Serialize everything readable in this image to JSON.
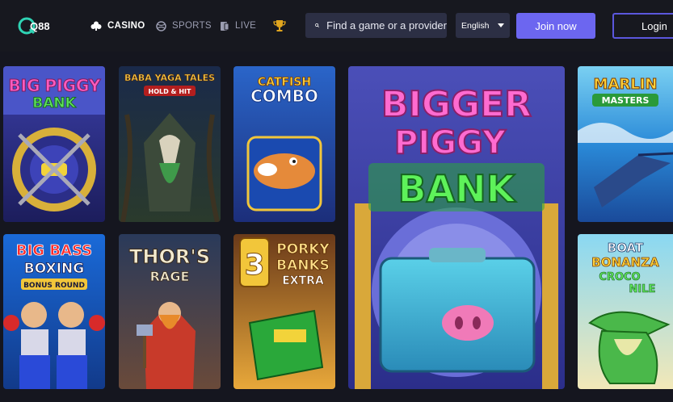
{
  "header": {
    "logo_text": "Q88",
    "nav": [
      {
        "label": "CASINO",
        "icon": "clubs-icon",
        "active": true
      },
      {
        "label": "SPORTS",
        "icon": "ball-icon",
        "active": false
      },
      {
        "label": "LIVE",
        "icon": "live-cards-icon",
        "active": false
      },
      {
        "label": "",
        "icon": "trophy-icon",
        "active": false
      }
    ],
    "search": {
      "placeholder": "Find a game or a provider"
    },
    "language": {
      "selected": "English"
    },
    "join_label": "Join now",
    "login_label": "Login"
  },
  "games": [
    {
      "title_lines": [
        "BIG",
        "PIGGY",
        "BANK"
      ]
    },
    {
      "title_lines": [
        "BABA YAGA TALES",
        "HOLD & HIT"
      ]
    },
    {
      "title_lines": [
        "CATFISH",
        "COMBO"
      ]
    },
    {
      "title_lines": [
        "BIGGER",
        "PIGGY",
        "BANK"
      ]
    },
    {
      "title_lines": [
        "MARLIN",
        "MASTERS"
      ]
    },
    {
      "title_lines": [
        "BIG BASS",
        "BOXING",
        "BONUS ROUND"
      ]
    },
    {
      "title_lines": [
        "THOR'S",
        "RAGE"
      ]
    },
    {
      "title_lines": [
        "3",
        "PORKY",
        "BANKS",
        "EXTRA"
      ]
    },
    {
      "title_lines": [
        "BOAT",
        "BONANZA",
        "CROCO",
        "NILE"
      ]
    }
  ],
  "colors": {
    "accent": "#6c66f0",
    "background": "#15161f",
    "header": "#17181f",
    "input": "#2c2f44"
  }
}
